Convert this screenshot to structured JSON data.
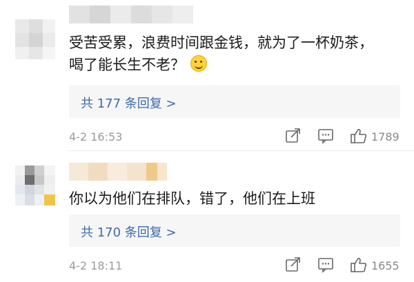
{
  "comments": [
    {
      "text_line1": "受苦受累，浪费时间跟金钱，就为了一杯奶茶，",
      "text_line2": "喝了能长生不老？",
      "emoji": "grinning-sweat-emoji",
      "replies": "共 177 条回复 >",
      "time": "4-2 16:53",
      "likes": "1789"
    },
    {
      "text_line1": "你以为他们在排队，错了，他们在上班",
      "replies": "共 170 条回复 >",
      "time": "4-2 18:11",
      "likes": "1655"
    }
  ],
  "icons": [
    "share-icon",
    "comment-icon",
    "like-icon"
  ],
  "colors": {
    "link": "#3b6aa8",
    "muted": "#999999",
    "reply_bg": "#f6f6f6"
  }
}
